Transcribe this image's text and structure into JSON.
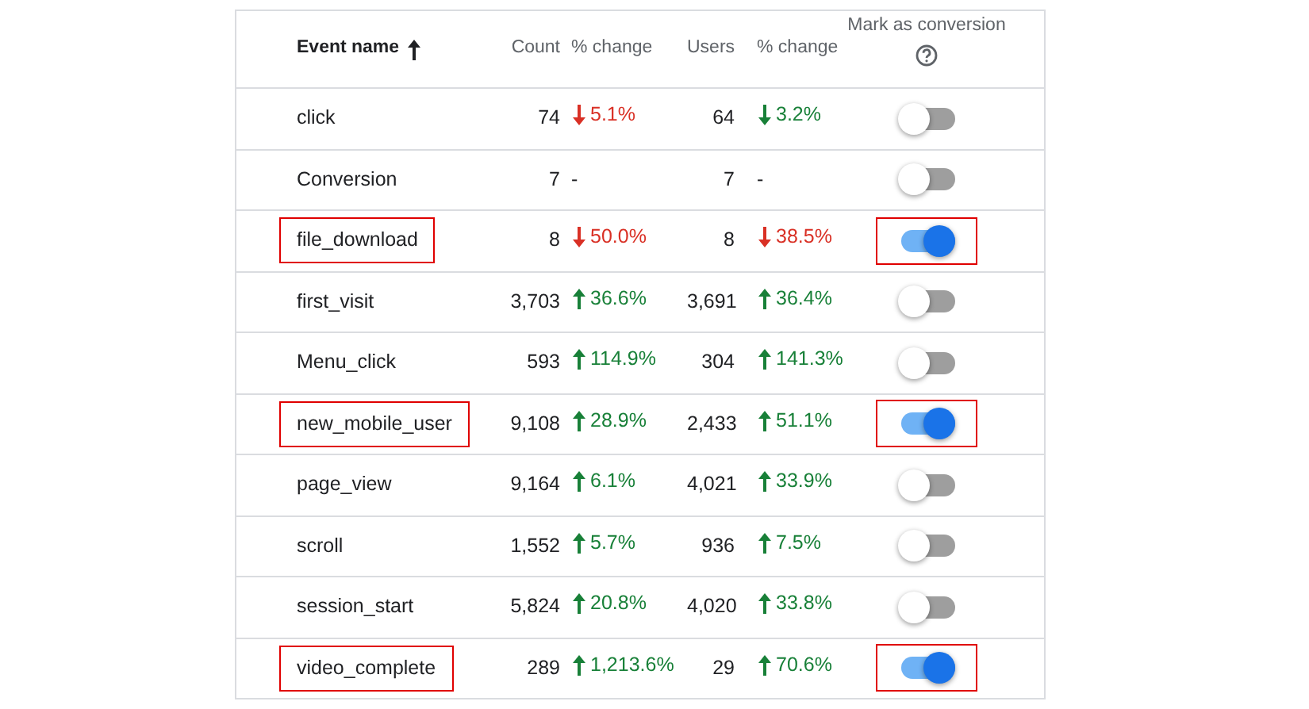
{
  "table": {
    "columns": [
      {
        "label": "Event name",
        "sorted": true
      },
      {
        "label": "Count"
      },
      {
        "label": "% change"
      },
      {
        "label": "Users"
      },
      {
        "label": "% change"
      },
      {
        "label": "Mark as conversion"
      }
    ],
    "rows": [
      {
        "name": "click",
        "count": "74",
        "count_change": {
          "text": "5.1%",
          "kind": "down",
          "color": "#d93025"
        },
        "users": "64",
        "users_change": {
          "text": "3.2%",
          "kind": "down",
          "color": "#188038"
        },
        "conversion": false,
        "highlighted": false
      },
      {
        "name": "Conversion",
        "count": "7",
        "count_change": {
          "text": "-",
          "kind": "none",
          "color": "#202124"
        },
        "users": "7",
        "users_change": {
          "text": "-",
          "kind": "none",
          "color": "#202124"
        },
        "conversion": false,
        "highlighted": false
      },
      {
        "name": "file_download",
        "count": "8",
        "count_change": {
          "text": "50.0%",
          "kind": "down",
          "color": "#d93025"
        },
        "users": "8",
        "users_change": {
          "text": "38.5%",
          "kind": "down",
          "color": "#d93025"
        },
        "conversion": true,
        "highlighted": true
      },
      {
        "name": "first_visit",
        "count": "3,703",
        "count_change": {
          "text": "36.6%",
          "kind": "up",
          "color": "#188038"
        },
        "users": "3,691",
        "users_change": {
          "text": "36.4%",
          "kind": "up",
          "color": "#188038"
        },
        "conversion": false,
        "highlighted": false
      },
      {
        "name": "Menu_click",
        "count": "593",
        "count_change": {
          "text": "114.9%",
          "kind": "up",
          "color": "#188038"
        },
        "users": "304",
        "users_change": {
          "text": "141.3%",
          "kind": "up",
          "color": "#188038"
        },
        "conversion": false,
        "highlighted": false
      },
      {
        "name": "new_mobile_user",
        "count": "9,108",
        "count_change": {
          "text": "28.9%",
          "kind": "up",
          "color": "#188038"
        },
        "users": "2,433",
        "users_change": {
          "text": "51.1%",
          "kind": "up",
          "color": "#188038"
        },
        "conversion": true,
        "highlighted": true
      },
      {
        "name": "page_view",
        "count": "9,164",
        "count_change": {
          "text": "6.1%",
          "kind": "up",
          "color": "#188038"
        },
        "users": "4,021",
        "users_change": {
          "text": "33.9%",
          "kind": "up",
          "color": "#188038"
        },
        "conversion": false,
        "highlighted": false
      },
      {
        "name": "scroll",
        "count": "1,552",
        "count_change": {
          "text": "5.7%",
          "kind": "up",
          "color": "#188038"
        },
        "users": "936",
        "users_change": {
          "text": "7.5%",
          "kind": "up",
          "color": "#188038"
        },
        "conversion": false,
        "highlighted": false
      },
      {
        "name": "session_start",
        "count": "5,824",
        "count_change": {
          "text": "20.8%",
          "kind": "up",
          "color": "#188038"
        },
        "users": "4,020",
        "users_change": {
          "text": "33.8%",
          "kind": "up",
          "color": "#188038"
        },
        "conversion": false,
        "highlighted": false
      },
      {
        "name": "video_complete",
        "count": "289",
        "count_change": {
          "text": "1,213.6%",
          "kind": "up",
          "color": "#188038"
        },
        "users": "29",
        "users_change": {
          "text": "70.6%",
          "kind": "up",
          "color": "#188038"
        },
        "conversion": true,
        "highlighted": true
      }
    ]
  }
}
